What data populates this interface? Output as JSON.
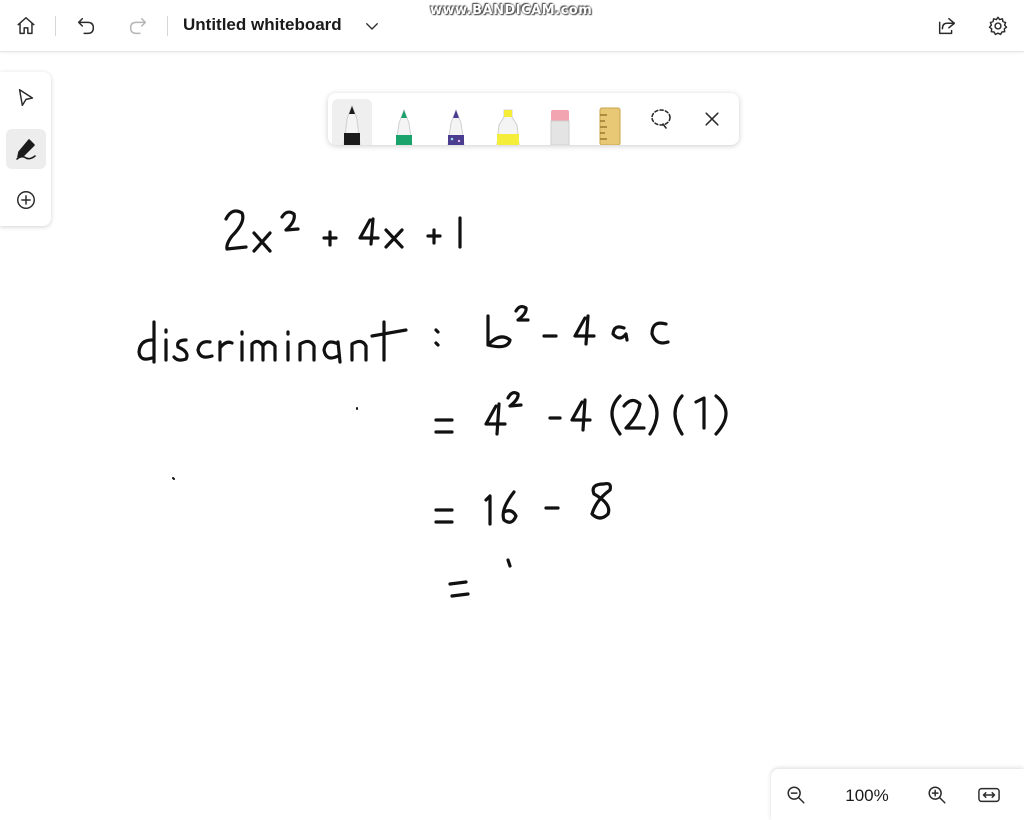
{
  "window": {
    "title": "Untitled whiteboard",
    "watermark": "www.BANDICAM.com"
  },
  "topbar": {
    "home_icon": "home-icon",
    "undo_icon": "undo-icon",
    "redo_icon": "redo-icon",
    "share_icon": "share-icon",
    "settings_icon": "gear-icon"
  },
  "rail": {
    "items": [
      {
        "name": "select-tool",
        "icon": "pointer-icon",
        "active": false
      },
      {
        "name": "inking-tool",
        "icon": "pen-icon",
        "active": true
      },
      {
        "name": "add-tool",
        "icon": "plus-circle-icon",
        "active": false
      }
    ]
  },
  "pen_tray": {
    "pens": [
      {
        "name": "black-pen",
        "color": "#1b1b1b",
        "active": true
      },
      {
        "name": "green-pen",
        "color": "#1aa36b",
        "active": false
      },
      {
        "name": "galaxy-pen",
        "color": "#4a3d8f",
        "active": false
      },
      {
        "name": "yellow-highlighter",
        "color": "#f4ee3a",
        "active": false
      },
      {
        "name": "eraser",
        "color": "#f2a4b0",
        "active": false
      },
      {
        "name": "ruler",
        "color": "#e8c874",
        "active": false
      }
    ],
    "lasso_icon": "lasso-select-icon",
    "close_icon": "close-icon"
  },
  "zoom": {
    "level": "100%",
    "zoom_out_icon": "zoom-out-icon",
    "zoom_in_icon": "zoom-in-icon",
    "fit_icon": "fit-width-icon"
  },
  "ink_notes": {
    "line1": "2x² + 4x + 1",
    "line2": "discriminant = b² - 4ac",
    "line3": "= 4² - 4(2)(1)",
    "line4": "= 16 - 8",
    "line5": "="
  }
}
